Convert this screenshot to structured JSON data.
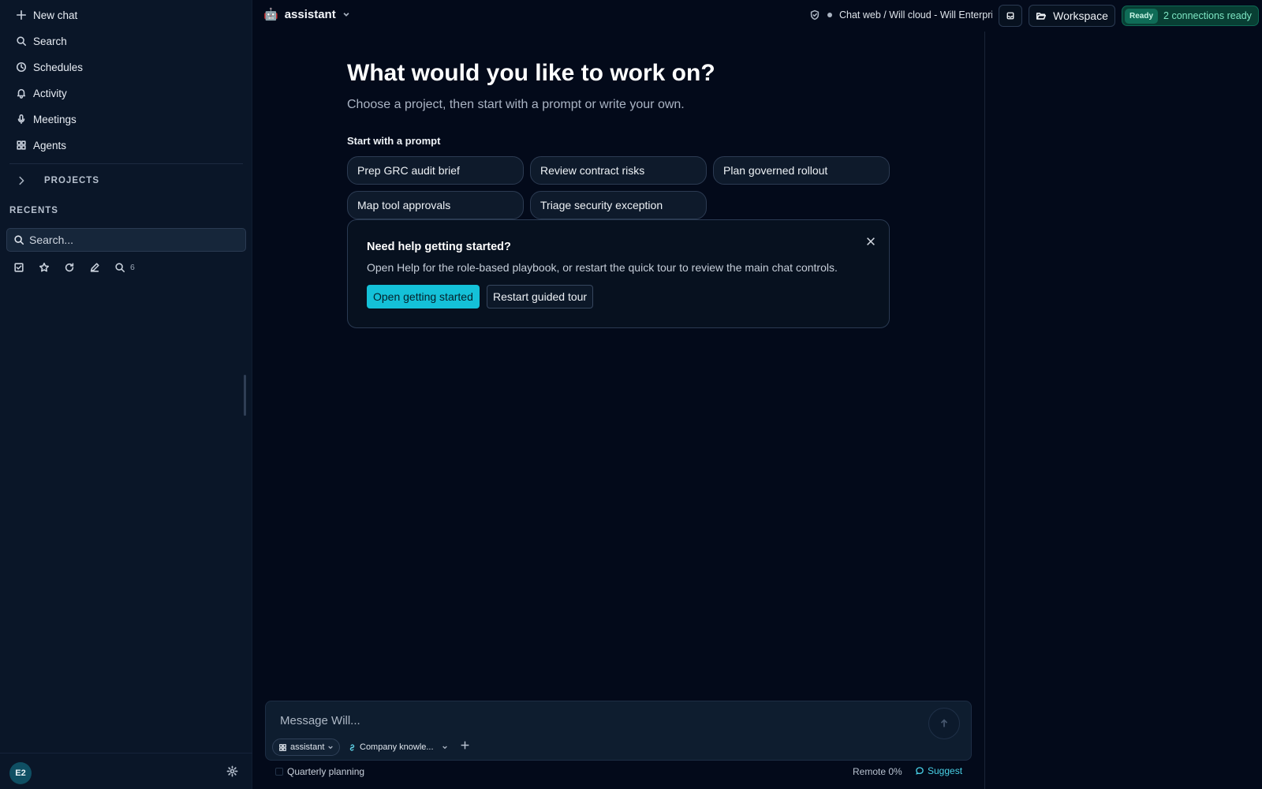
{
  "sidebar": {
    "nav": [
      {
        "label": "New chat",
        "icon": "plus-icon"
      },
      {
        "label": "Search",
        "icon": "search-icon"
      },
      {
        "label": "Schedules",
        "icon": "clock-icon"
      },
      {
        "label": "Activity",
        "icon": "bell-icon"
      },
      {
        "label": "Meetings",
        "icon": "microphone-icon"
      },
      {
        "label": "Agents",
        "icon": "grid-icon"
      }
    ],
    "projects_label": "PROJECTS",
    "recents_label": "RECENTS",
    "search_placeholder": "Search...",
    "filter_count": "6",
    "avatar_initials": "E2"
  },
  "header": {
    "agent_name": "assistant",
    "environment": "Chat web / Will cloud - Will Enterprise",
    "workspace_label": "Workspace",
    "ready_badge": "Ready",
    "connections": "2 connections ready"
  },
  "main": {
    "title": "What would you like to work on?",
    "subtitle": "Choose a project, then start with a prompt or write your own.",
    "prompt_section_label": "Start with a prompt",
    "prompts": [
      "Prep GRC audit brief",
      "Review contract risks",
      "Plan governed rollout",
      "Map tool approvals",
      "Triage security exception"
    ],
    "help": {
      "title": "Need help getting started?",
      "text": "Open Help for the role-based playbook, or restart the quick tour to review the main chat controls.",
      "primary_label": "Open getting started",
      "secondary_label": "Restart guided tour"
    }
  },
  "composer": {
    "placeholder": "Message Will...",
    "agent_chip": "assistant",
    "knowledge_chip": "Company knowle...",
    "project": "Quarterly planning",
    "remote": "Remote 0%",
    "suggest": "Suggest"
  },
  "colors": {
    "background": "#030a1a",
    "sidebar": "#0a1628",
    "accent": "#14c1d8",
    "ready": "#0f6c57"
  }
}
